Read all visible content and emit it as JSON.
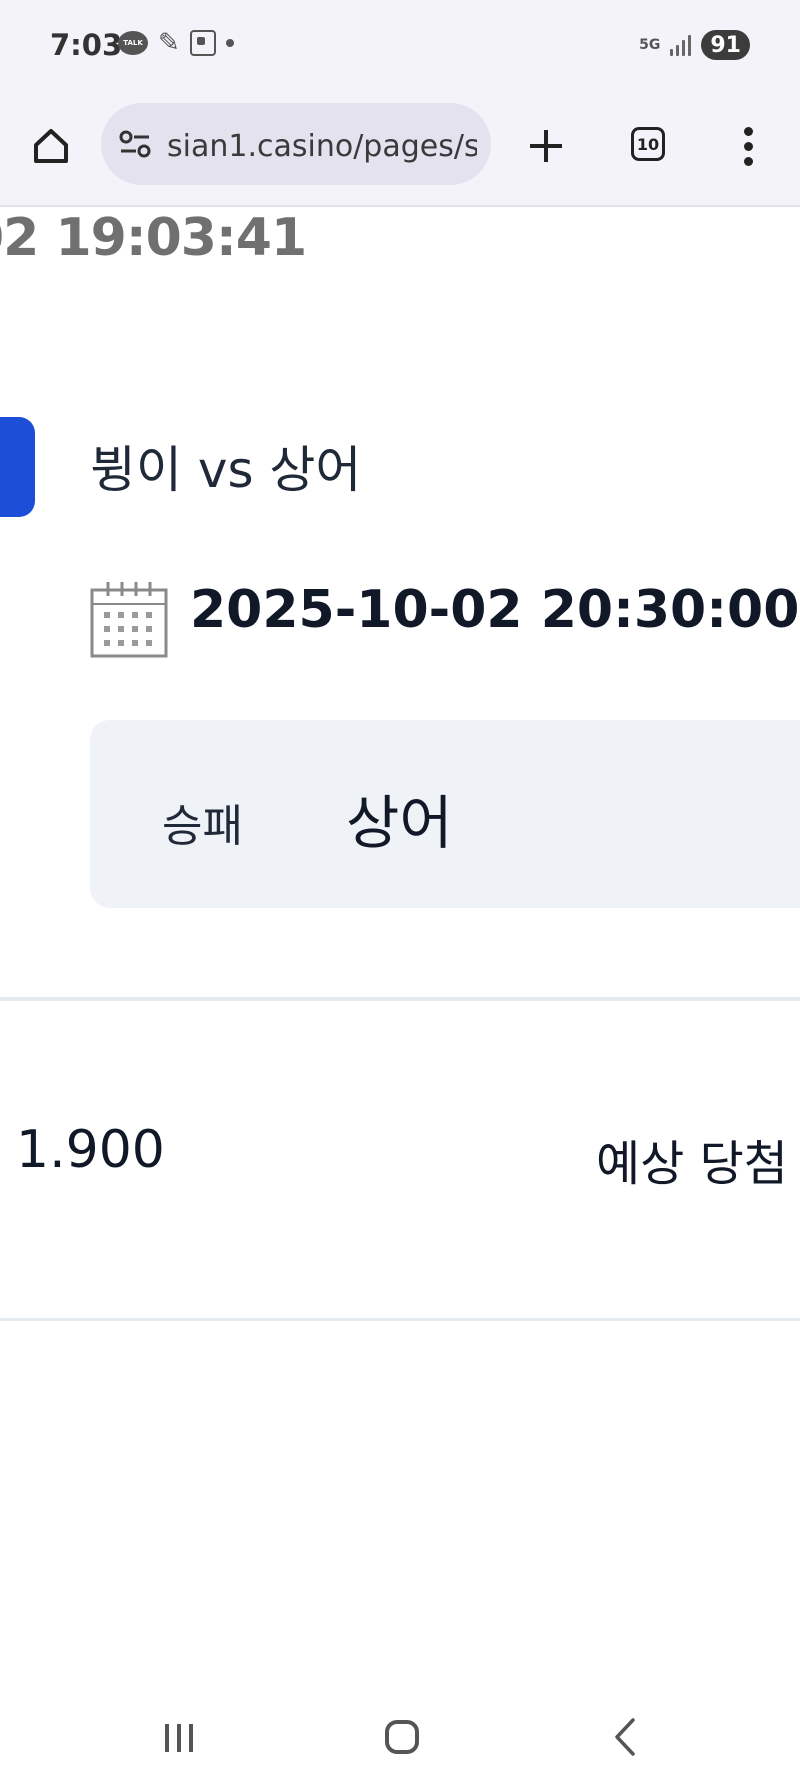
{
  "status_bar": {
    "time": "7:03",
    "talk_badge": "TALK",
    "network": "5G",
    "battery": "91"
  },
  "browser": {
    "url": "sian1.casino/pages/s",
    "tab_count": "10"
  },
  "page": {
    "datetime_top": "02 19:03:41",
    "match_title": "뷩이 vs 상어",
    "match_date": "2025-10-02 20:30:00",
    "pick_type": "승패",
    "pick_value": "상어",
    "odds": "1.900",
    "expected_label": "예상 당첨"
  },
  "colors": {
    "accent_blue": "#1d4ed8",
    "pick_box_bg": "#eff2f7",
    "browser_bg": "#f4f3fa"
  }
}
